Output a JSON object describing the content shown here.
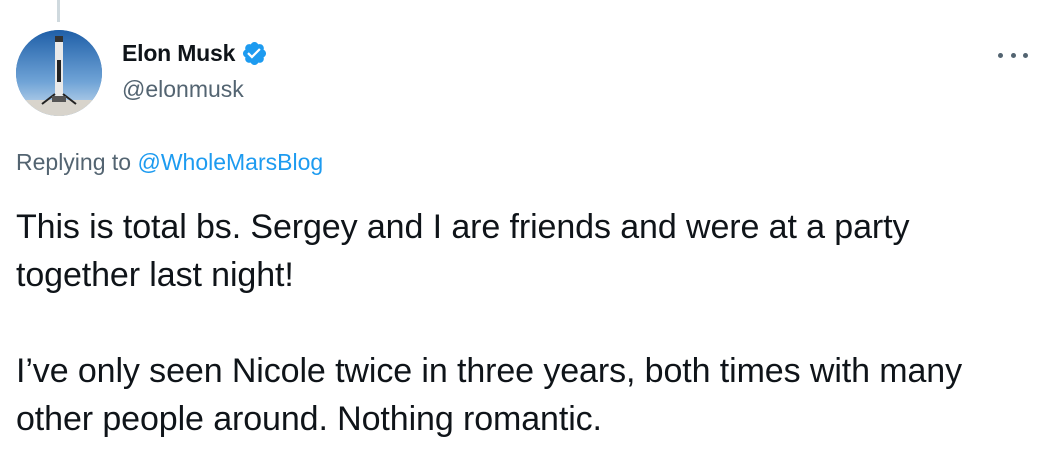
{
  "author": {
    "display_name": "Elon Musk",
    "handle": "@elonmusk",
    "verified_icon": "verified-badge-icon",
    "avatar_icon": "rocket-avatar"
  },
  "reply": {
    "prefix": "Replying to ",
    "mention": "@WholeMarsBlog"
  },
  "tweet": {
    "paragraph_1": "This is total bs. Sergey and I are friends and were at a party together last night!",
    "paragraph_2": "I’ve only seen Nicole twice in three years, both times with many other people around. Nothing romantic."
  },
  "colors": {
    "text": "#0f1419",
    "secondary": "#536471",
    "accent": "#1d9bf0"
  }
}
